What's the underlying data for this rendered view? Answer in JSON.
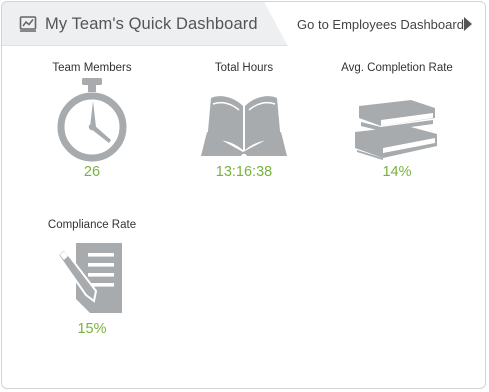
{
  "header": {
    "title": "My Team's Quick Dashboard",
    "title_icon": "chart-board-icon",
    "link_label": "Go to Employees Dashboard",
    "link_icon": "triangle-right-icon"
  },
  "tiles": [
    {
      "label": "Team Members",
      "value": "26",
      "icon": "stopwatch-icon"
    },
    {
      "label": "Total Hours",
      "value": "13:16:38",
      "icon": "open-book-icon"
    },
    {
      "label": "Avg. Completion Rate",
      "value": "14%",
      "icon": "stacked-books-icon"
    },
    {
      "label": "Compliance Rate",
      "value": "15%",
      "icon": "document-pen-icon"
    }
  ],
  "colors": {
    "accent_value": "#79b23c",
    "icon_gray": "#a7abad",
    "header_bg": "#eeeff1"
  }
}
